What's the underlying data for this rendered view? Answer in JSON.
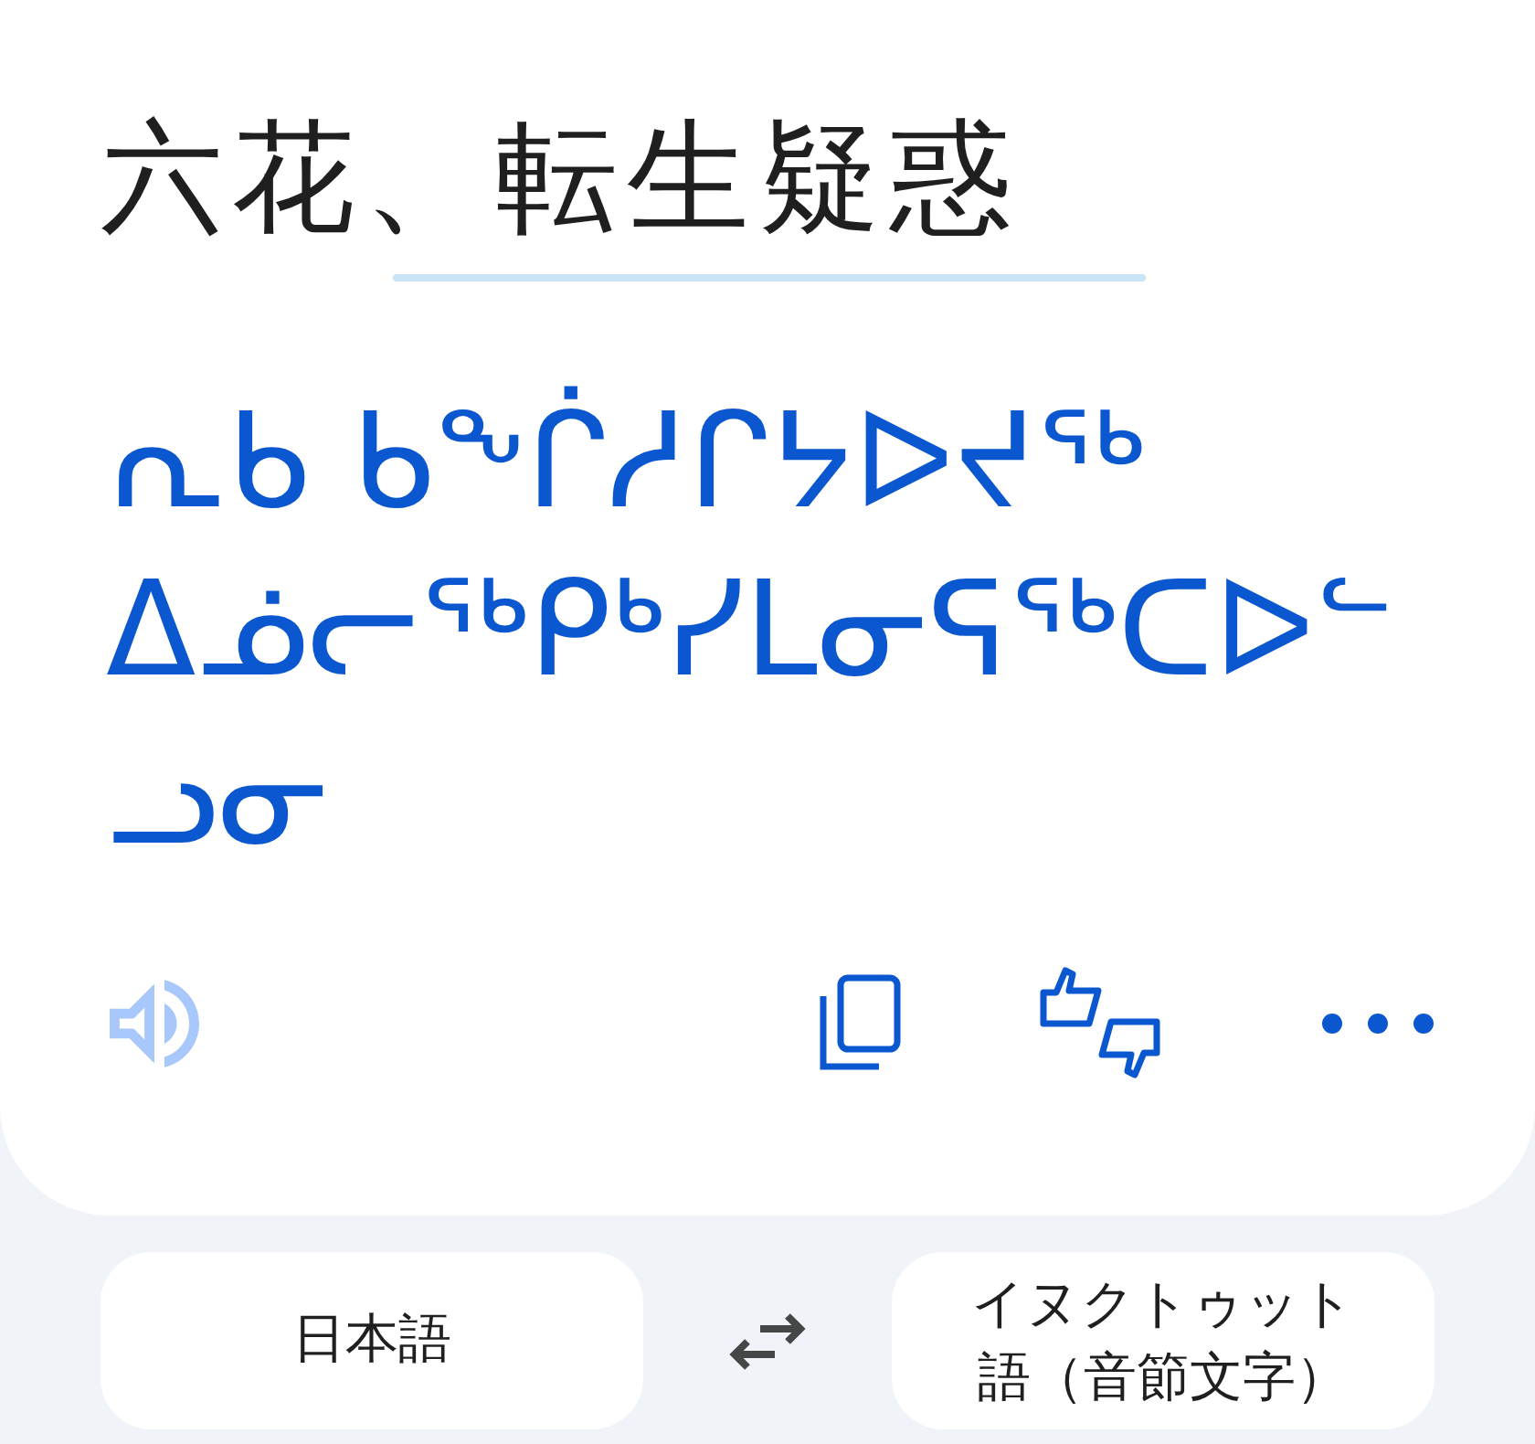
{
  "source": {
    "text": "六花、転生疑惑"
  },
  "translation": {
    "text": "ᕆᑲ ᑲᖕᒌᓱᒋᔭᐅᔪᖅ ᐃᓅᓕᖅᑭᒃᓯᒪᓂᕋᖅᑕᐅᓪᓗᓂ"
  },
  "speaker_button": {
    "disabled": true
  },
  "languages": {
    "source": "日本語",
    "target": "イヌクトゥット語（音節文字）"
  }
}
